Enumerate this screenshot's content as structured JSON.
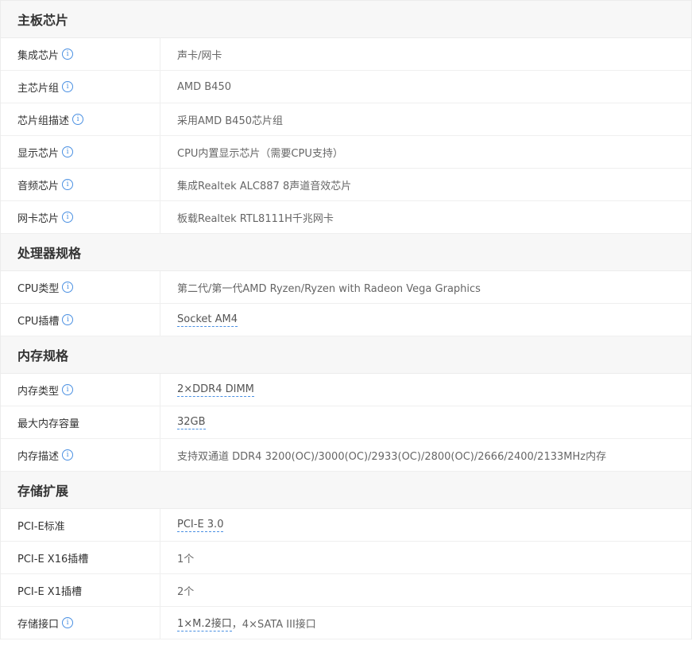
{
  "sections": [
    {
      "title": "主板芯片",
      "rows": [
        {
          "label": "集成芯片",
          "info": true,
          "value": "声卡/网卡",
          "link": false
        },
        {
          "label": "主芯片组",
          "info": true,
          "value": "AMD B450",
          "link": false
        },
        {
          "label": "芯片组描述",
          "info": true,
          "value": "采用AMD B450芯片组",
          "link": false
        },
        {
          "label": "显示芯片",
          "info": true,
          "value": "CPU内置显示芯片（需要CPU支持）",
          "link": false
        },
        {
          "label": "音频芯片",
          "info": true,
          "value": "集成Realtek ALC887 8声道音效芯片",
          "link": false
        },
        {
          "label": "网卡芯片",
          "info": true,
          "value": "板载Realtek RTL8111H千兆网卡",
          "link": false
        }
      ]
    },
    {
      "title": "处理器规格",
      "rows": [
        {
          "label": "CPU类型",
          "info": true,
          "value": "第二代/第一代AMD Ryzen/Ryzen with Radeon Vega Graphics",
          "link": false
        },
        {
          "label": "CPU插槽",
          "info": true,
          "value": "Socket AM4",
          "link": true
        }
      ]
    },
    {
      "title": "内存规格",
      "rows": [
        {
          "label": "内存类型",
          "info": true,
          "value": "2×DDR4 DIMM",
          "link": true
        },
        {
          "label": "最大内存容量",
          "info": false,
          "value": "32GB",
          "link": true
        },
        {
          "label": "内存描述",
          "info": true,
          "value": "支持双通道 DDR4 3200(OC)/3000(OC)/2933(OC)/2800(OC)/2666/2400/2133MHz内存",
          "link": false
        }
      ]
    },
    {
      "title": "存储扩展",
      "rows": [
        {
          "label": "PCI-E标准",
          "info": false,
          "value": "PCI-E 3.0",
          "link": true
        },
        {
          "label": "PCI-E X16插槽",
          "info": false,
          "value": "1个",
          "link": false
        },
        {
          "label": "PCI-E X1插槽",
          "info": false,
          "value": "2个",
          "link": false
        },
        {
          "label": "存储接口",
          "info": true,
          "value": "",
          "link": false,
          "parts": [
            {
              "text": "1×M.2接口",
              "link": true
            },
            {
              "text": "，4×SATA III接口",
              "link": false
            }
          ]
        }
      ]
    }
  ],
  "icons": {
    "info": "info-icon",
    "info_glyph": "i"
  },
  "colors": {
    "accent": "#4a90e2",
    "header_bg": "#f7f7f7"
  }
}
